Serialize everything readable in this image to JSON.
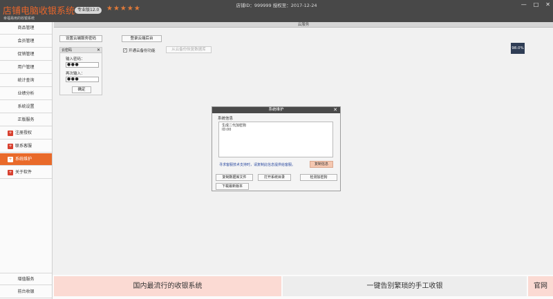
{
  "titlebar": {
    "app_title": "店铺电脑收银系统",
    "app_subtitle": "幸福易用的收银系统",
    "version_badge": "专业版12.0",
    "rating_stars": "★★★★★",
    "shop_info": "店铺ID：999999 授权至：2017-12-24",
    "min_glyph": "—",
    "max_glyph": "□",
    "close_glyph": "✕"
  },
  "sidebar": {
    "items": [
      {
        "label": "商品管理"
      },
      {
        "label": "会员管理"
      },
      {
        "label": "促销管理"
      },
      {
        "label": "用户管理"
      },
      {
        "label": "统计查询"
      },
      {
        "label": "业绩分析"
      },
      {
        "label": "系统设置"
      },
      {
        "label": "正版服务"
      }
    ],
    "sub_items": [
      {
        "label": "注册授权",
        "icon": "+"
      },
      {
        "label": "联系客服",
        "icon": "+"
      },
      {
        "label": "系统维护",
        "icon": "+",
        "active": true
      },
      {
        "label": "关于软件",
        "icon": "+"
      }
    ],
    "bottom_items": [
      {
        "label": "增值服务"
      },
      {
        "label": "前台收银"
      }
    ]
  },
  "main": {
    "panel_title": "云服务",
    "set_cloud_password_button": "设置云端服务密码",
    "login_cloud_backend_button": "登录云端后台",
    "cloud_backup_checkbox_label": "开通云备份功能",
    "cloud_backup_checked": true,
    "restore_backup_button": "从云备份恢复数据库",
    "progress_percent": "98.0%"
  },
  "password_box": {
    "title": "云密码",
    "close_glyph": "✕",
    "input_password_label": "输入密码：",
    "input_password_value": "●●●",
    "confirm_password_label": "再次输入：",
    "confirm_password_value": "●●●",
    "confirm_button": "确定"
  },
  "dialog": {
    "title": "系统维护",
    "close_glyph": "✕",
    "system_info_label": "系统信息",
    "system_info_lines": [
      "生成二代加密狗",
      "ID:00"
    ],
    "support_note": "寻求客服技术支持时，请复制此信息提供给客服。",
    "copy_info_button": "复制信息",
    "copy_database_button": "复制数据库文件",
    "open_system_dir_button": "打开系统目录",
    "check_dongle_button": "检测加密狗",
    "download_latest_button": "下载最新版本"
  },
  "bottom": {
    "left_banner": "国内最流行的收银系统",
    "mid_banner": "一键告别繁琐的手工收银",
    "right_banner": "官网"
  },
  "colors": {
    "titlebar_bg": "#484848",
    "accent_orange": "#e96a2a",
    "banner_pink": "#fbdad3",
    "dialog_note_blue": "#2b4aa0"
  }
}
